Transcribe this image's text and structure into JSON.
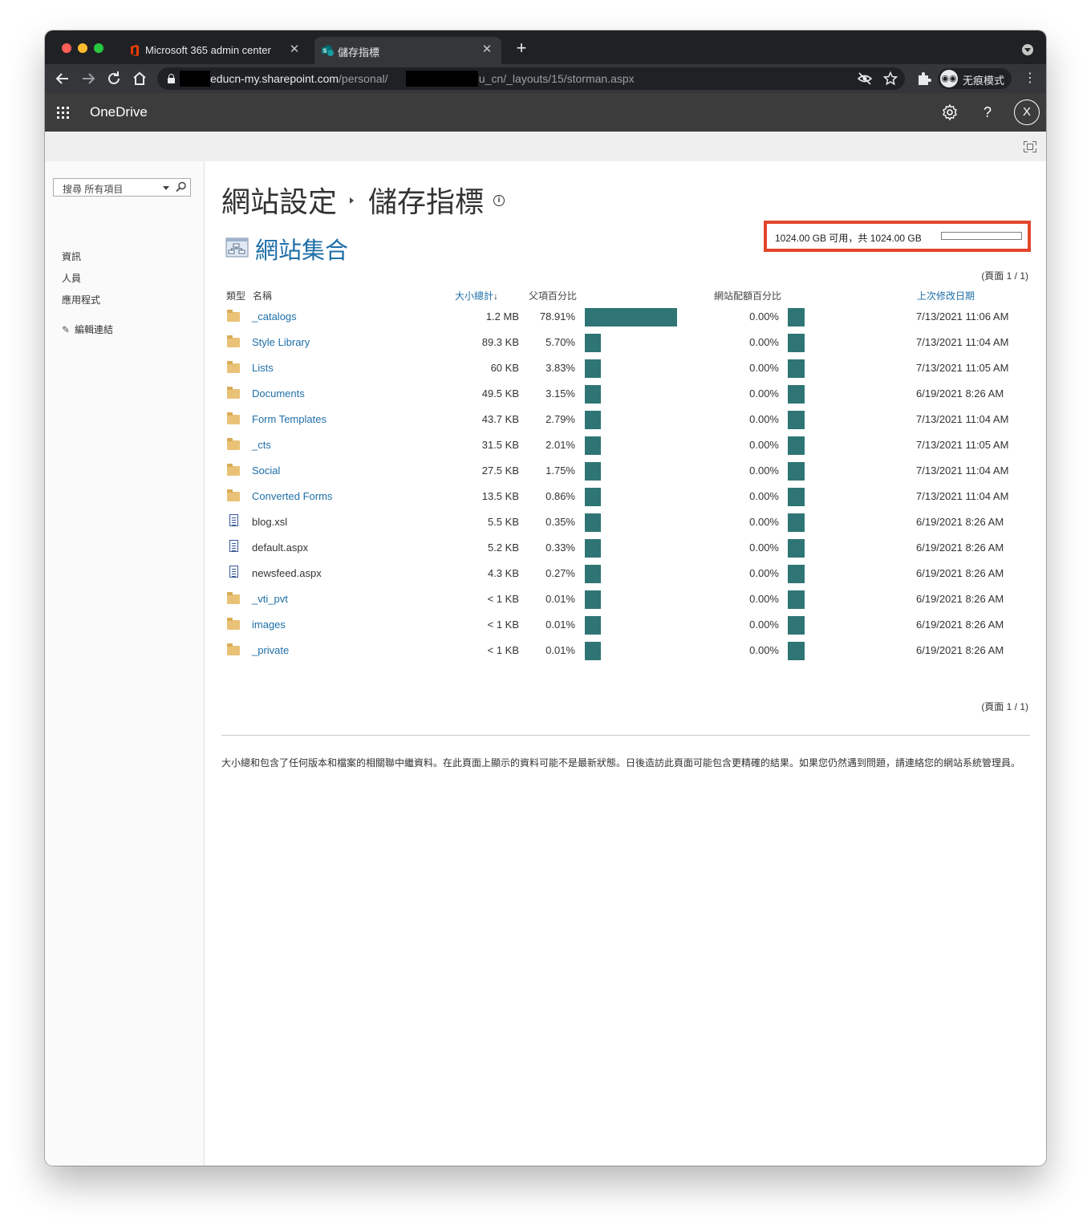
{
  "browser": {
    "tabs": [
      {
        "title": "Microsoft 365 admin center",
        "close": "✕"
      },
      {
        "title": "儲存指標",
        "close": "✕"
      }
    ],
    "new_tab": "+",
    "url_host": "educn-my.sharepoint.com",
    "url_path_1": "/personal/",
    "url_path_2": "_edu_cn/_layouts/15/storman.aspx",
    "incognito_label": "无痕模式",
    "icons": [
      "back-icon",
      "forward-icon",
      "reload-icon",
      "home-icon",
      "lock-icon",
      "eye-off-icon",
      "star-icon",
      "puzzle-icon",
      "incognito-icon",
      "kebab-icon"
    ]
  },
  "suite": {
    "app_name": "OneDrive",
    "help": "?",
    "user_initial": "X"
  },
  "leftnav": {
    "search_placeholder": "搜尋 所有項目",
    "items": [
      "資訊",
      "人員",
      "應用程式"
    ],
    "edit_links": "編輯連結"
  },
  "header": {
    "breadcrumb_parent": "網站設定",
    "breadcrumb_current": "儲存指標",
    "section_title": "網站集合",
    "quota_text": "1024.00 GB 可用，共 1024.00 GB",
    "quota_used_fraction": 0.0,
    "pager_top": "(頁面 1 / 1)",
    "pager_bottom": "(頁面 1 / 1)"
  },
  "table": {
    "columns": {
      "type": "類型",
      "name": "名稱",
      "total_size": "大小總計",
      "sort_indicator": "↓",
      "parent_pct": "父項百分比",
      "quota_pct": "網站配額百分比",
      "modified": "上次修改日期"
    },
    "rows": [
      {
        "kind": "folder",
        "name": "_catalogs",
        "size": "1.2 MB",
        "parent_pct": "78.91%",
        "parent_value": 78.91,
        "quota_pct": "0.00%",
        "modified": "7/13/2021 11:06 AM"
      },
      {
        "kind": "folder",
        "name": "Style Library",
        "size": "89.3 KB",
        "parent_pct": "5.70%",
        "parent_value": 5.7,
        "quota_pct": "0.00%",
        "modified": "7/13/2021 11:04 AM"
      },
      {
        "kind": "folder",
        "name": "Lists",
        "size": "60 KB",
        "parent_pct": "3.83%",
        "parent_value": 3.83,
        "quota_pct": "0.00%",
        "modified": "7/13/2021 11:05 AM"
      },
      {
        "kind": "folder",
        "name": "Documents",
        "size": "49.5 KB",
        "parent_pct": "3.15%",
        "parent_value": 3.15,
        "quota_pct": "0.00%",
        "modified": "6/19/2021 8:26 AM"
      },
      {
        "kind": "folder",
        "name": "Form Templates",
        "size": "43.7 KB",
        "parent_pct": "2.79%",
        "parent_value": 2.79,
        "quota_pct": "0.00%",
        "modified": "7/13/2021 11:04 AM"
      },
      {
        "kind": "folder",
        "name": "_cts",
        "size": "31.5 KB",
        "parent_pct": "2.01%",
        "parent_value": 2.01,
        "quota_pct": "0.00%",
        "modified": "7/13/2021 11:05 AM"
      },
      {
        "kind": "folder",
        "name": "Social",
        "size": "27.5 KB",
        "parent_pct": "1.75%",
        "parent_value": 1.75,
        "quota_pct": "0.00%",
        "modified": "7/13/2021 11:04 AM"
      },
      {
        "kind": "folder",
        "name": "Converted Forms",
        "size": "13.5 KB",
        "parent_pct": "0.86%",
        "parent_value": 0.86,
        "quota_pct": "0.00%",
        "modified": "7/13/2021 11:04 AM"
      },
      {
        "kind": "file",
        "name": "blog.xsl",
        "size": "5.5 KB",
        "parent_pct": "0.35%",
        "parent_value": 0.35,
        "quota_pct": "0.00%",
        "modified": "6/19/2021 8:26 AM"
      },
      {
        "kind": "file",
        "name": "default.aspx",
        "size": "5.2 KB",
        "parent_pct": "0.33%",
        "parent_value": 0.33,
        "quota_pct": "0.00%",
        "modified": "6/19/2021 8:26 AM"
      },
      {
        "kind": "file",
        "name": "newsfeed.aspx",
        "size": "4.3 KB",
        "parent_pct": "0.27%",
        "parent_value": 0.27,
        "quota_pct": "0.00%",
        "modified": "6/19/2021 8:26 AM"
      },
      {
        "kind": "folder",
        "name": "_vti_pvt",
        "size": "< 1 KB",
        "parent_pct": "0.01%",
        "parent_value": 0.01,
        "quota_pct": "0.00%",
        "modified": "6/19/2021 8:26 AM"
      },
      {
        "kind": "folder",
        "name": "images",
        "size": "< 1 KB",
        "parent_pct": "0.01%",
        "parent_value": 0.01,
        "quota_pct": "0.00%",
        "modified": "6/19/2021 8:26 AM"
      },
      {
        "kind": "folder",
        "name": "_private",
        "size": "< 1 KB",
        "parent_pct": "0.01%",
        "parent_value": 0.01,
        "quota_pct": "0.00%",
        "modified": "6/19/2021 8:26 AM"
      }
    ]
  },
  "footnote": "大小總和包含了任何版本和檔案的相關聯中繼資料。在此頁面上顯示的資料可能不是最新狀態。日後造訪此頁面可能包含更精確的結果。如果您仍然遇到問題，請連絡您的網站系統管理員。",
  "colors": {
    "bar": "#2f7575",
    "link": "#1e6fa8",
    "highlight_border": "#e2452b",
    "suite_bar": "#3c3c3c"
  }
}
